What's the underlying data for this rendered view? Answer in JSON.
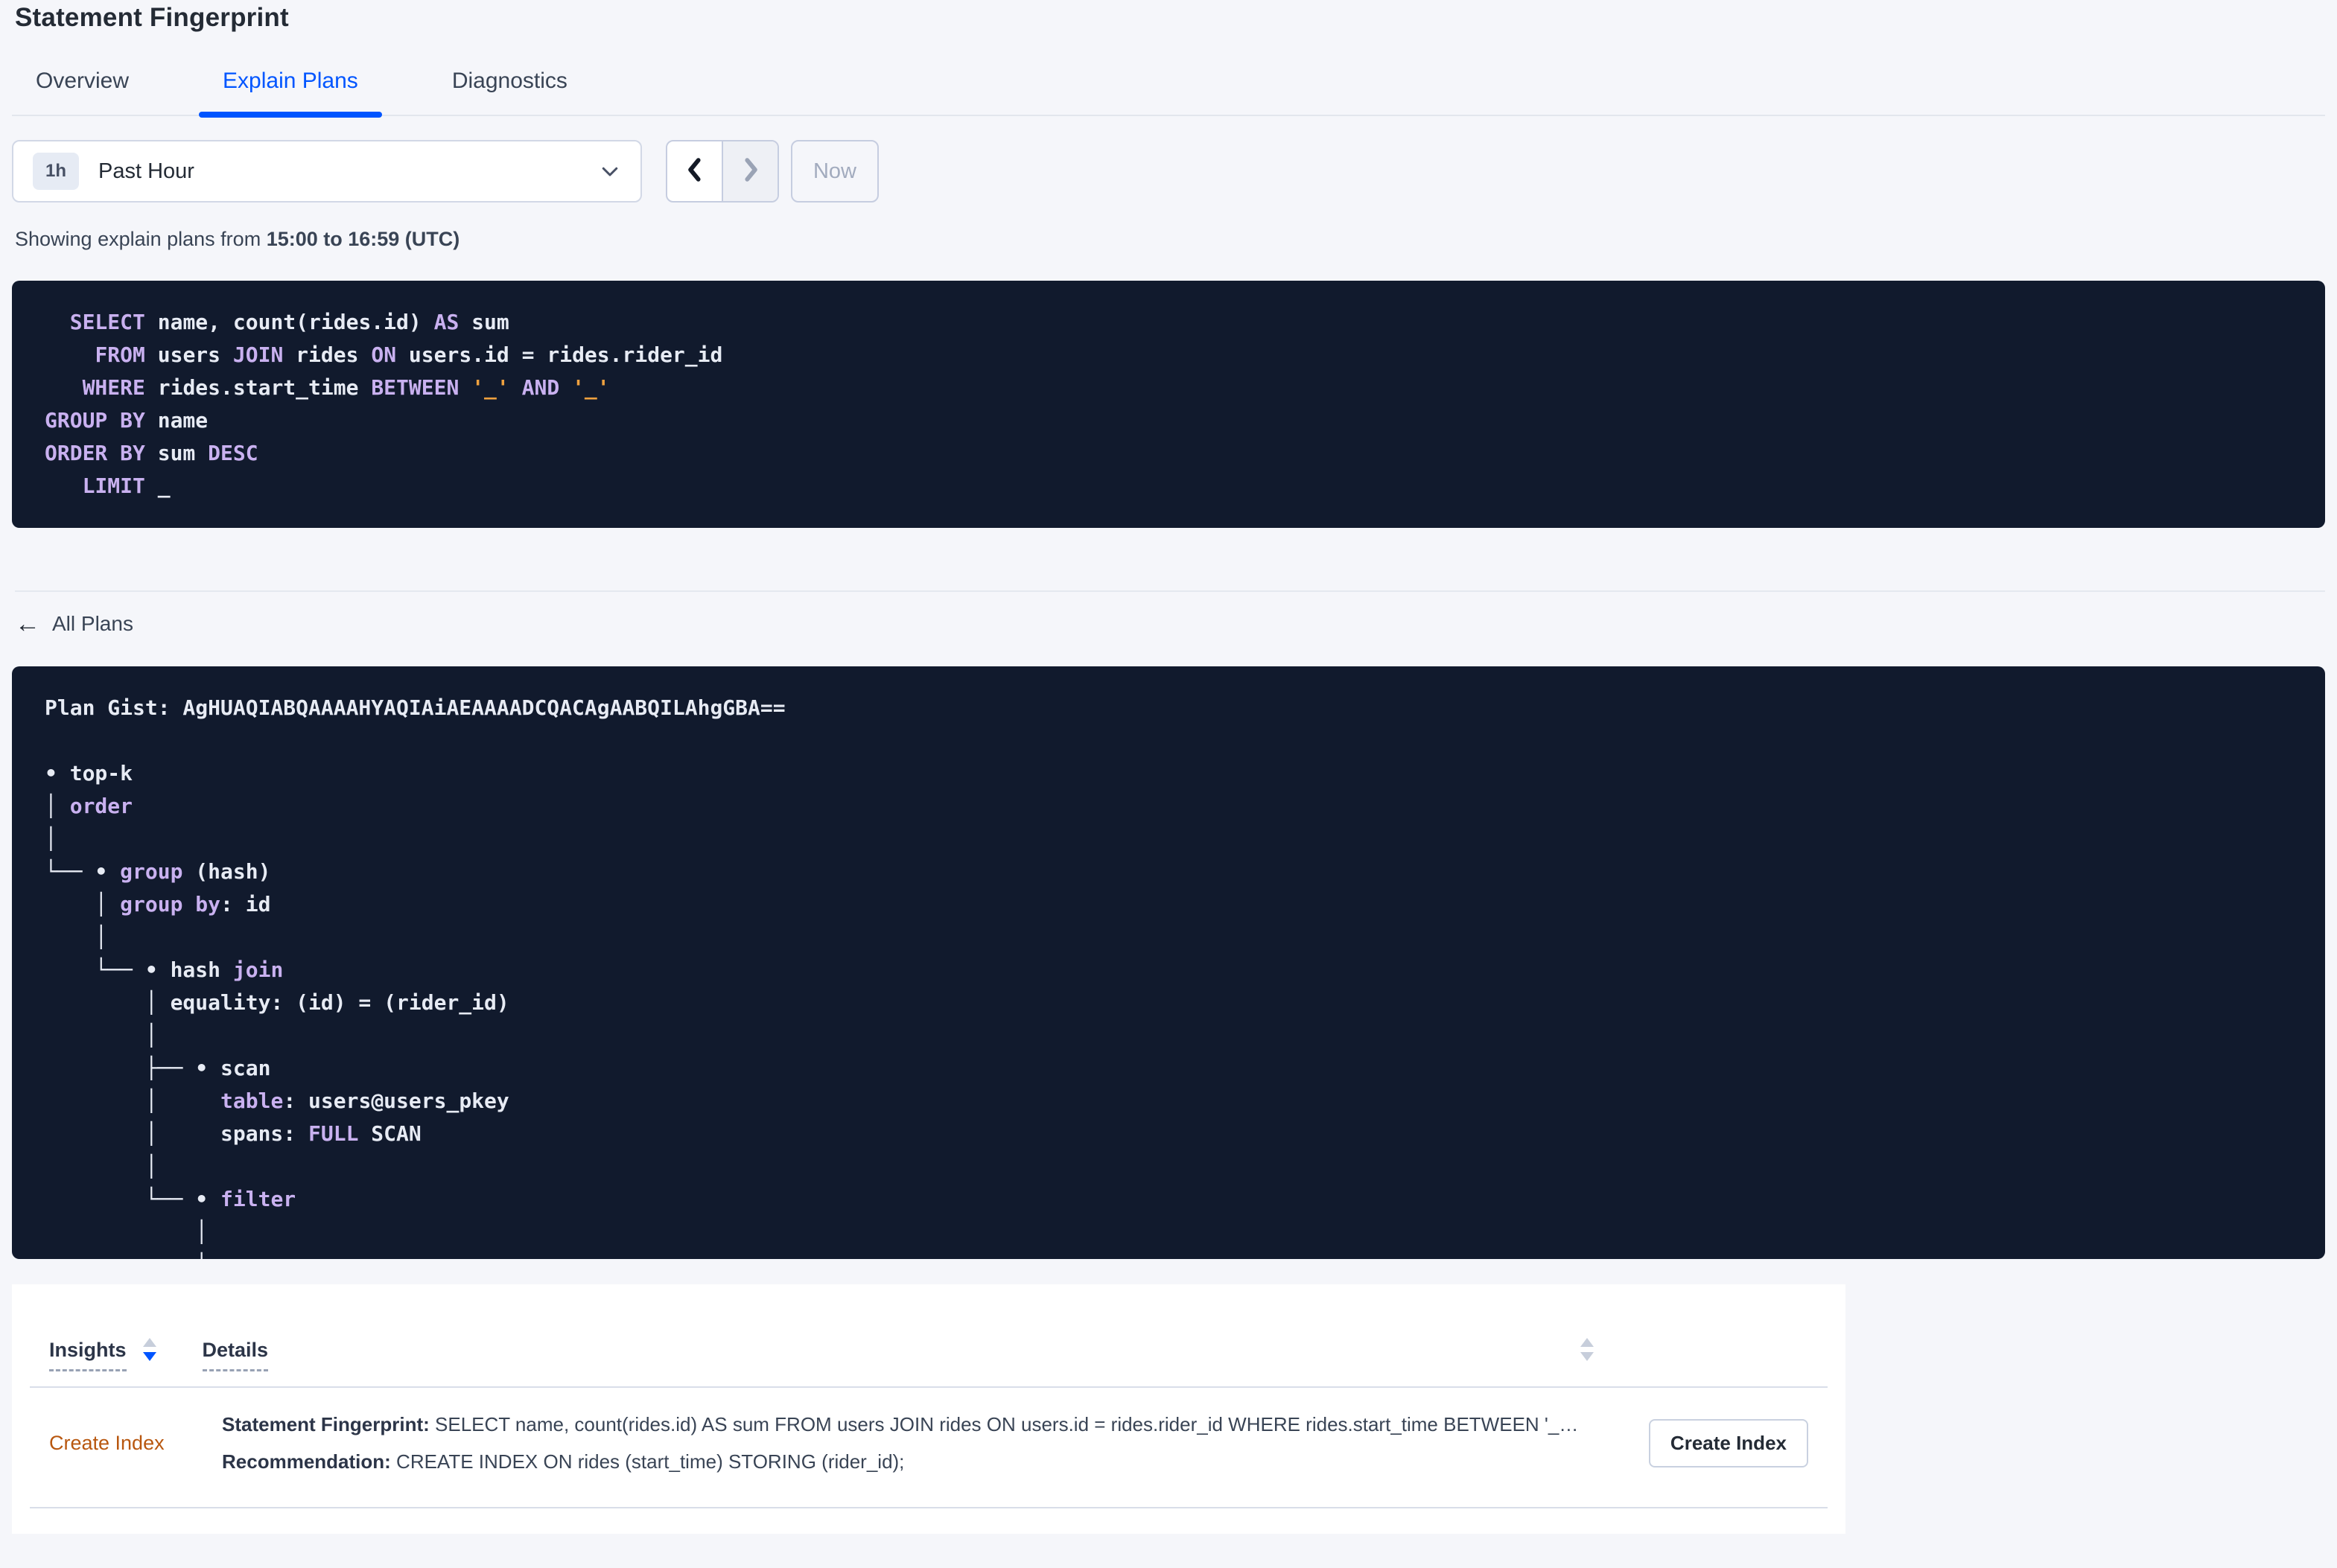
{
  "page": {
    "title": "Statement Fingerprint"
  },
  "tabs": [
    {
      "label": "Overview",
      "active": false
    },
    {
      "label": "Explain Plans",
      "active": true
    },
    {
      "label": "Diagnostics",
      "active": false
    }
  ],
  "time_picker": {
    "interval_badge": "1h",
    "selected_label": "Past Hour",
    "now_label": "Now"
  },
  "subtitle": {
    "prefix": "Showing explain plans from ",
    "range_bold": "15:00 to 16:59 (UTC)"
  },
  "sql_statement": {
    "lines": [
      [
        {
          "c": "p",
          "t": "  "
        },
        {
          "c": "k",
          "t": "SELECT"
        },
        {
          "c": "p",
          "t": " name, count(rides.id) "
        },
        {
          "c": "k",
          "t": "AS"
        },
        {
          "c": "p",
          "t": " sum"
        }
      ],
      [
        {
          "c": "p",
          "t": "    "
        },
        {
          "c": "k",
          "t": "FROM"
        },
        {
          "c": "p",
          "t": " users "
        },
        {
          "c": "k",
          "t": "JOIN"
        },
        {
          "c": "p",
          "t": " rides "
        },
        {
          "c": "k",
          "t": "ON"
        },
        {
          "c": "p",
          "t": " users.id = rides.rider_id"
        }
      ],
      [
        {
          "c": "p",
          "t": "   "
        },
        {
          "c": "k",
          "t": "WHERE"
        },
        {
          "c": "p",
          "t": " rides.start_time "
        },
        {
          "c": "k",
          "t": "BETWEEN"
        },
        {
          "c": "p",
          "t": " "
        },
        {
          "c": "l",
          "t": "'_'"
        },
        {
          "c": "p",
          "t": " "
        },
        {
          "c": "k",
          "t": "AND"
        },
        {
          "c": "p",
          "t": " "
        },
        {
          "c": "l",
          "t": "'_'"
        }
      ],
      [
        {
          "c": "k",
          "t": "GROUP BY"
        },
        {
          "c": "p",
          "t": " name"
        }
      ],
      [
        {
          "c": "k",
          "t": "ORDER BY"
        },
        {
          "c": "p",
          "t": " sum "
        },
        {
          "c": "k",
          "t": "DESC"
        }
      ],
      [
        {
          "c": "p",
          "t": "   "
        },
        {
          "c": "k",
          "t": "LIMIT"
        },
        {
          "c": "p",
          "t": " _"
        }
      ]
    ]
  },
  "back_link": {
    "label": "All Plans",
    "arrow": "←"
  },
  "plan_view": {
    "gist": "AgHUAQIABQAAAAHYAQIAiAEAAAADCQACAgAABQILAhgGBA==",
    "lines": [
      [
        {
          "c": "p",
          "t": "Plan Gist: AgHUAQIABQAAAAHYAQIAiAEAAAADCQACAgAABQILAhgGBA=="
        }
      ],
      [],
      [
        {
          "c": "p",
          "t": "• top-k"
        }
      ],
      [
        {
          "c": "p",
          "t": "│ "
        },
        {
          "c": "k",
          "t": "order"
        }
      ],
      [
        {
          "c": "p",
          "t": "│"
        }
      ],
      [
        {
          "c": "p",
          "t": "└── • "
        },
        {
          "c": "k",
          "t": "group"
        },
        {
          "c": "p",
          "t": " (hash)"
        }
      ],
      [
        {
          "c": "p",
          "t": "    │ "
        },
        {
          "c": "k",
          "t": "group by"
        },
        {
          "c": "p",
          "t": ": id"
        }
      ],
      [
        {
          "c": "p",
          "t": "    │"
        }
      ],
      [
        {
          "c": "p",
          "t": "    └── • hash "
        },
        {
          "c": "k",
          "t": "join"
        }
      ],
      [
        {
          "c": "p",
          "t": "        │ equality: (id) = (rider_id)"
        }
      ],
      [
        {
          "c": "p",
          "t": "        │"
        }
      ],
      [
        {
          "c": "p",
          "t": "        ├── • scan"
        }
      ],
      [
        {
          "c": "p",
          "t": "        │     "
        },
        {
          "c": "k",
          "t": "table"
        },
        {
          "c": "p",
          "t": ": users@users_pkey"
        }
      ],
      [
        {
          "c": "p",
          "t": "        │     spans: "
        },
        {
          "c": "k",
          "t": "FULL"
        },
        {
          "c": "p",
          "t": " SCAN"
        }
      ],
      [
        {
          "c": "p",
          "t": "        │"
        }
      ],
      [
        {
          "c": "p",
          "t": "        └── • "
        },
        {
          "c": "k",
          "t": "filter"
        }
      ],
      [
        {
          "c": "p",
          "t": "            │"
        }
      ],
      [
        {
          "c": "p",
          "t": "            │"
        }
      ]
    ]
  },
  "insights_table": {
    "columns": [
      {
        "label": "Insights",
        "sort": "desc"
      },
      {
        "label": "Details",
        "sort": "none"
      }
    ],
    "row": {
      "insight_type": "Create Index",
      "detail_lines": [
        {
          "label": "Statement Fingerprint:",
          "text": " SELECT name, count(rides.id) AS sum FROM users JOIN rides ON users.id = rides.rider_id WHERE rides.start_time BETWEEN '_…"
        },
        {
          "label": "Recommendation:",
          "text": " CREATE INDEX ON rides (start_time) STORING (rider_id);"
        }
      ],
      "action_label": "Create Index"
    }
  },
  "colors": {
    "accent": "#0055ff",
    "panel_bg": "#111a2d",
    "keyword": "#c9b1f0",
    "literal": "#efa13f",
    "insight": "#b8570f"
  }
}
